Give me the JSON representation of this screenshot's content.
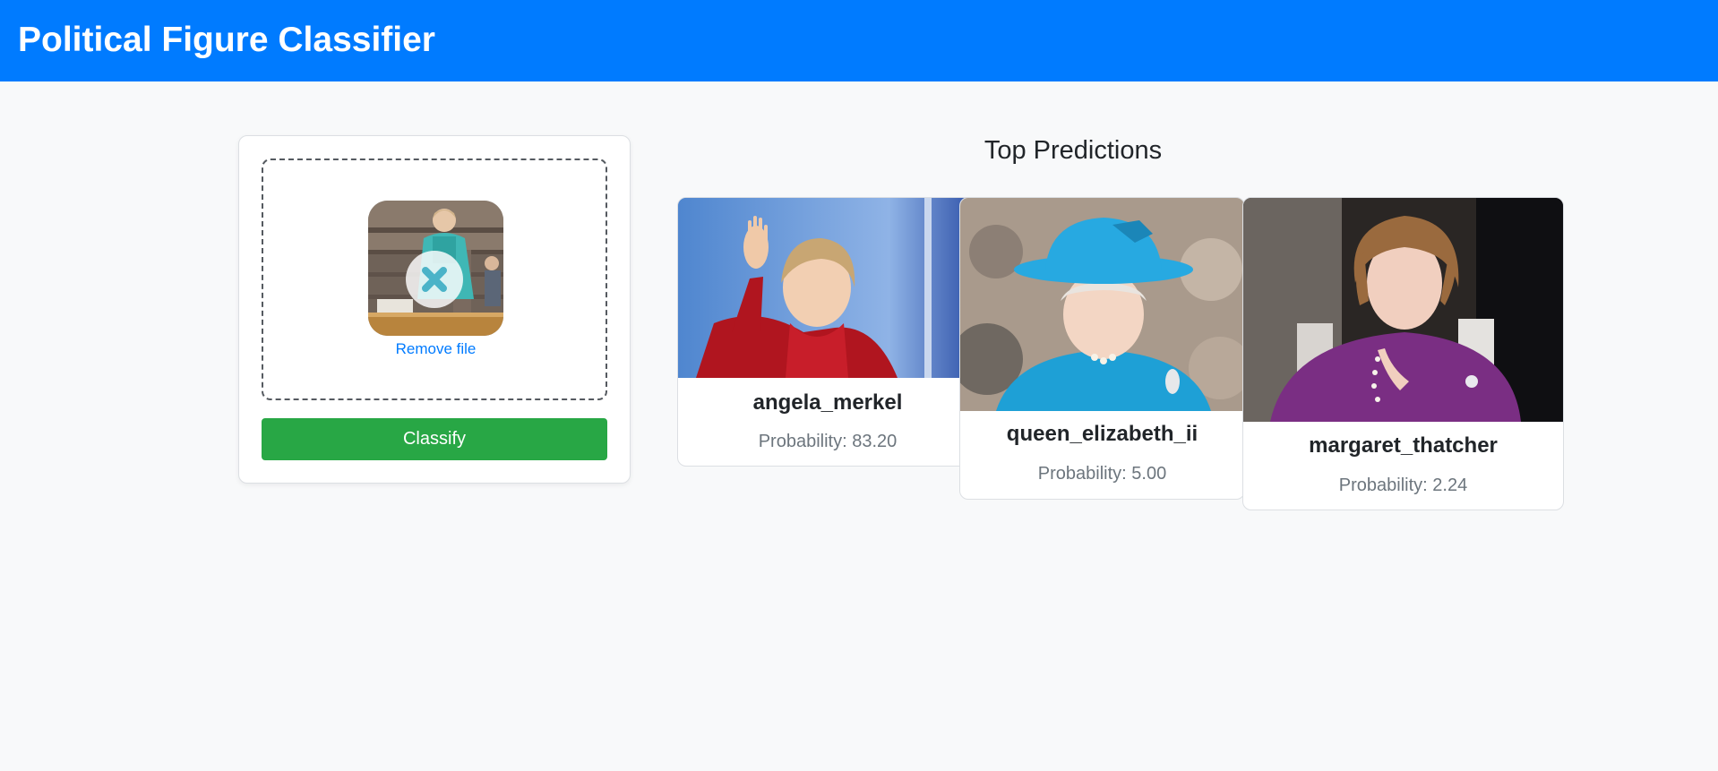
{
  "app": {
    "title": "Political Figure Classifier",
    "accent_color": "#007bff"
  },
  "upload": {
    "uploaded_image": "angela-merkel-photo",
    "remove_icon": "close-icon",
    "remove_label": "Remove file",
    "classify_label": "Classify",
    "classify_color": "#28a745"
  },
  "predictions": {
    "title": "Top Predictions",
    "prob_prefix": "Probability: ",
    "items": [
      {
        "name": "angela_merkel",
        "probability": "83.20",
        "image": "angela-merkel-photo"
      },
      {
        "name": "queen_elizabeth_ii",
        "probability": "5.00",
        "image": "queen-elizabeth-photo"
      },
      {
        "name": "margaret_thatcher",
        "probability": "2.24",
        "image": "margaret-thatcher-photo"
      }
    ]
  }
}
